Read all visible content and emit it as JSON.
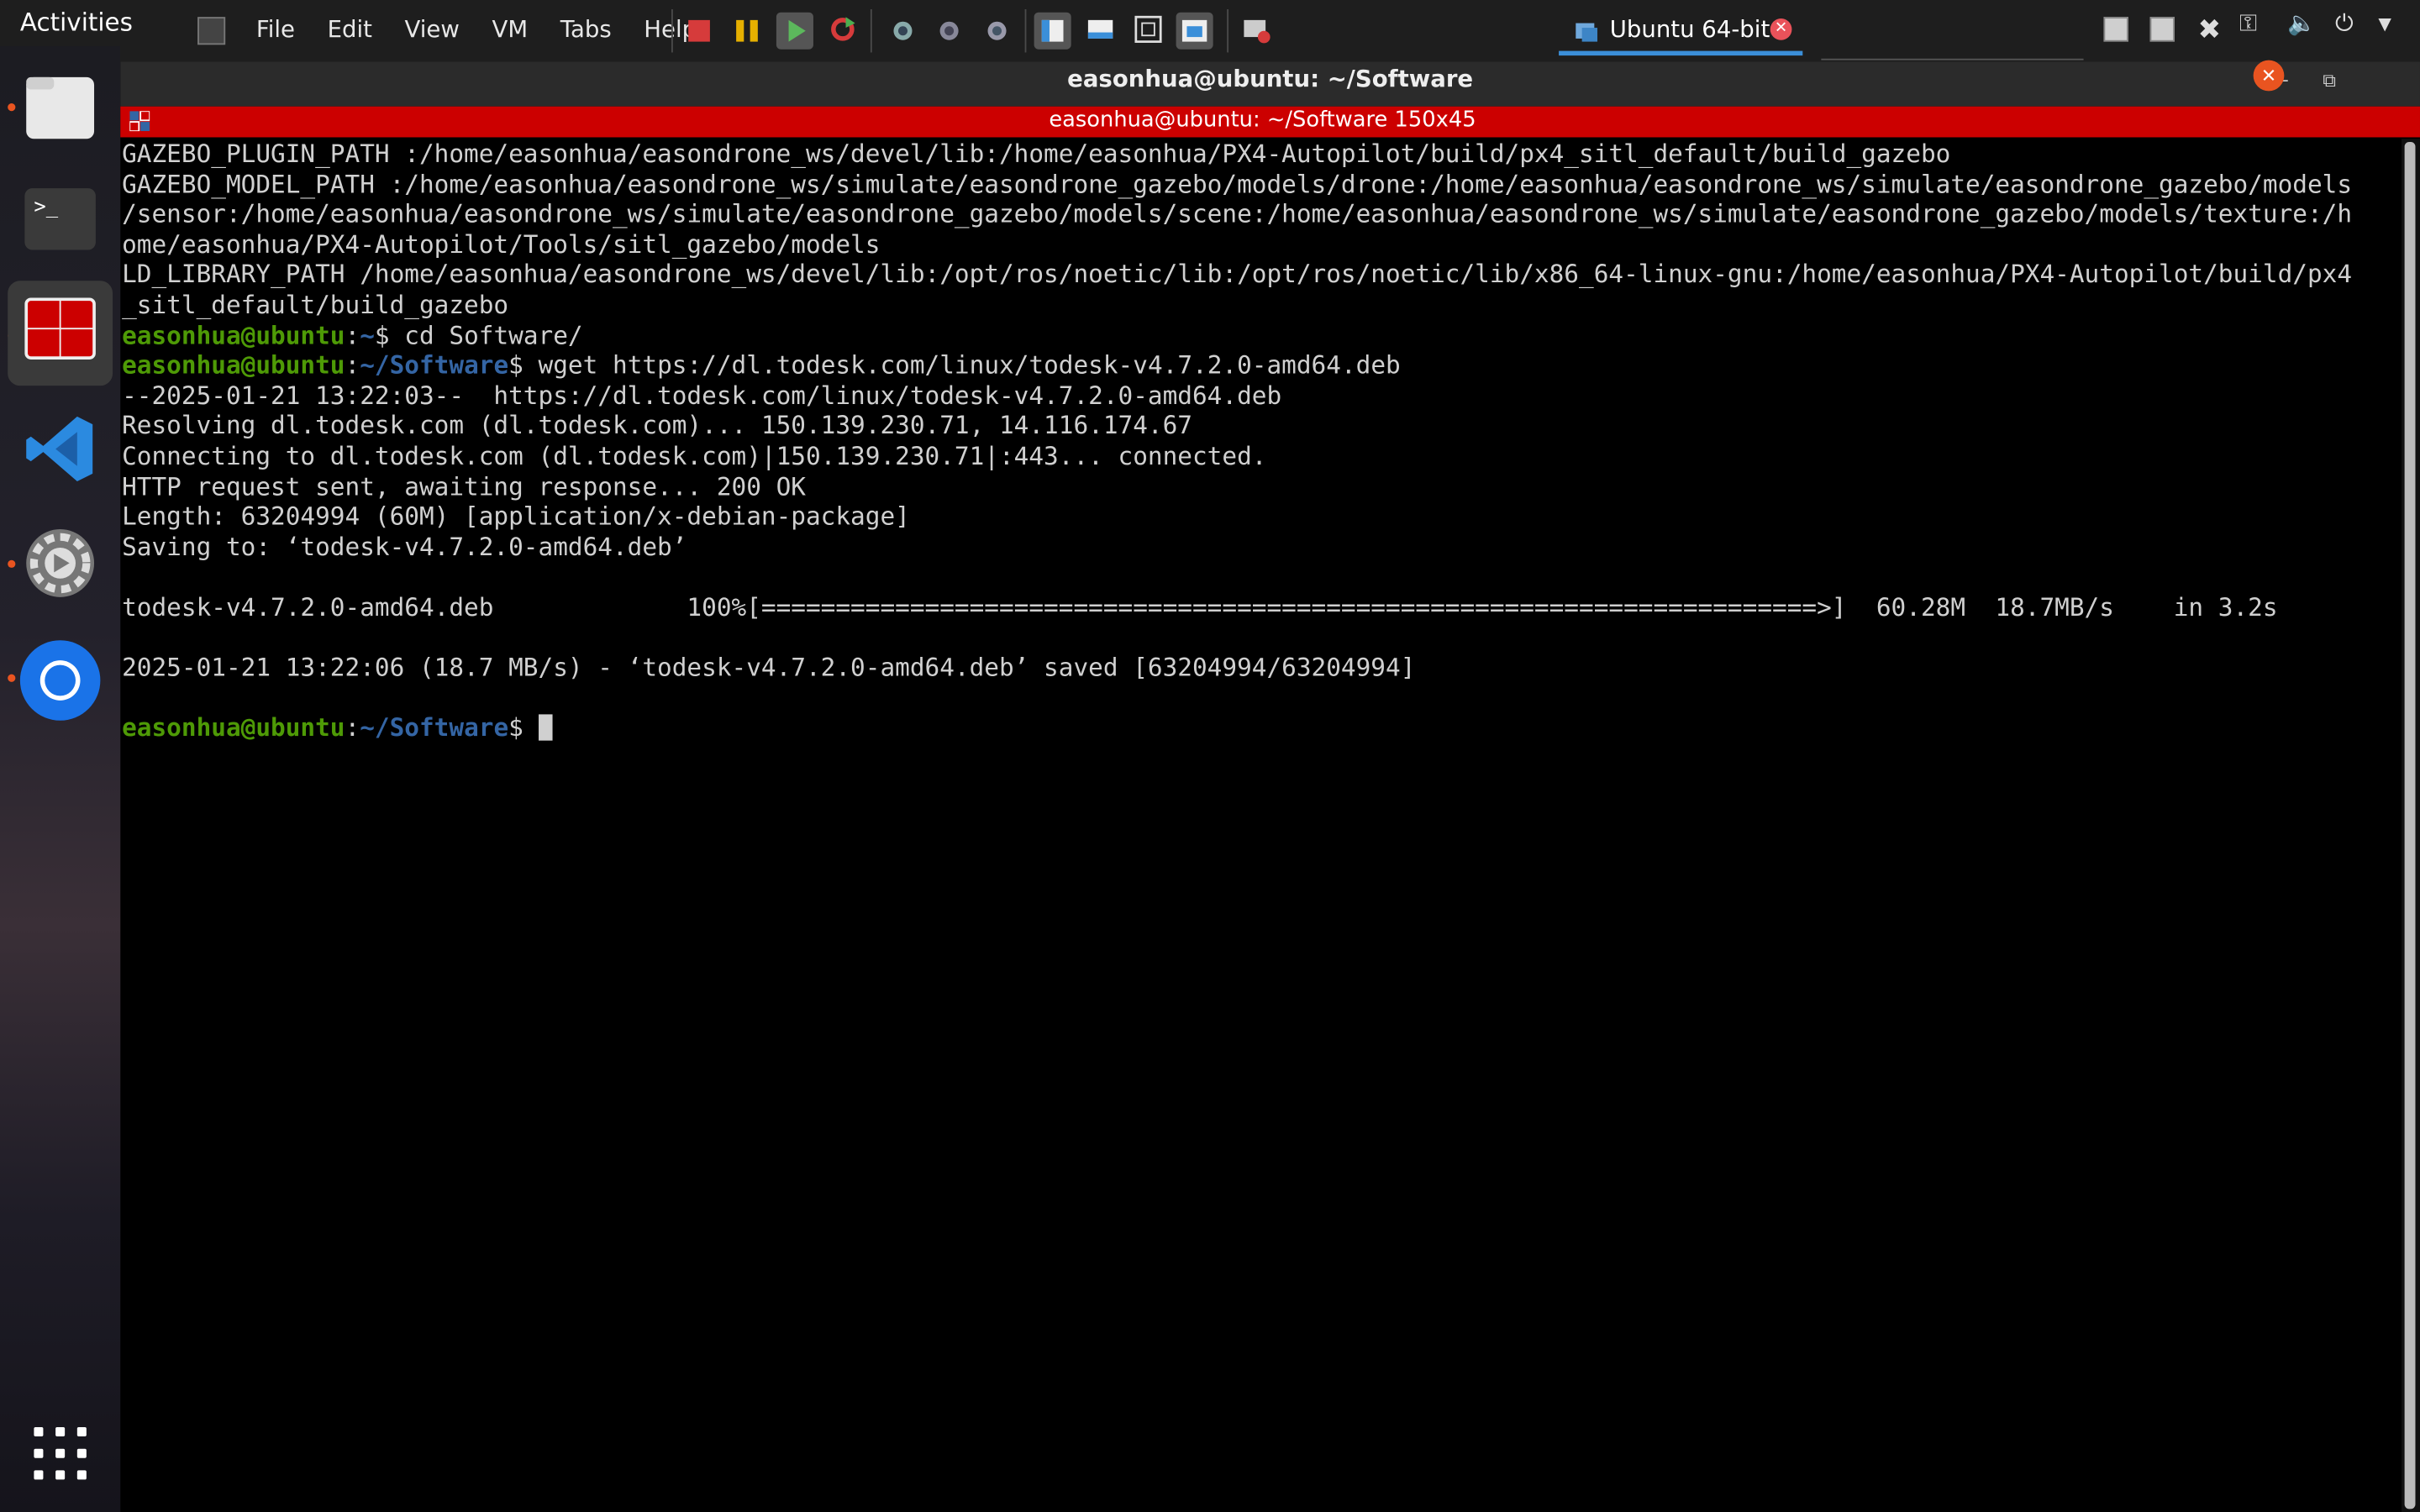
{
  "topbar": {
    "activities": "Activities",
    "menu": [
      "File",
      "Edit",
      "View",
      "VM",
      "Tabs",
      "Help"
    ],
    "vm_tab": "Ubuntu 64-bit"
  },
  "window": {
    "title": "easonhua@ubuntu: ~/Software",
    "terminal_title": "easonhua@ubuntu: ~/Software 150x45"
  },
  "terminal": {
    "lines": [
      "GAZEBO_PLUGIN_PATH :/home/easonhua/easondrone_ws/devel/lib:/home/easonhua/PX4-Autopilot/build/px4_sitl_default/build_gazebo",
      "GAZEBO_MODEL_PATH :/home/easonhua/easondrone_ws/simulate/easondrone_gazebo/models/drone:/home/easonhua/easondrone_ws/simulate/easondrone_gazebo/models",
      "/sensor:/home/easonhua/easondrone_ws/simulate/easondrone_gazebo/models/scene:/home/easonhua/easondrone_ws/simulate/easondrone_gazebo/models/texture:/h",
      "ome/easonhua/PX4-Autopilot/Tools/sitl_gazebo/models",
      "LD_LIBRARY_PATH /home/easonhua/easondrone_ws/devel/lib:/opt/ros/noetic/lib:/opt/ros/noetic/lib/x86_64-linux-gnu:/home/easonhua/PX4-Autopilot/build/px4",
      "_sitl_default/build_gazebo"
    ],
    "prompt_user": "easonhua@ubuntu",
    "prompt1_path": "~",
    "cmd1": "$ cd Software/",
    "prompt2_path": "~/Software",
    "cmd2": "$ wget https://dl.todesk.com/linux/todesk-v4.7.2.0-amd64.deb",
    "output": [
      "--2025-01-21 13:22:03--  https://dl.todesk.com/linux/todesk-v4.7.2.0-amd64.deb",
      "Resolving dl.todesk.com (dl.todesk.com)... 150.139.230.71, 14.116.174.67",
      "Connecting to dl.todesk.com (dl.todesk.com)|150.139.230.71|:443... connected.",
      "HTTP request sent, awaiting response... 200 OK",
      "Length: 63204994 (60M) [application/x-debian-package]",
      "Saving to: ‘todesk-v4.7.2.0-amd64.deb’",
      "",
      "todesk-v4.7.2.0-amd64.deb             100%[=======================================================================>]  60.28M  18.7MB/s    in 3.2s",
      "",
      "2025-01-21 13:22:06 (18.7 MB/s) - ‘todesk-v4.7.2.0-amd64.deb’ saved [63204994/63204994]",
      ""
    ],
    "prompt3_path": "~/Software",
    "cmd3": "$ "
  }
}
